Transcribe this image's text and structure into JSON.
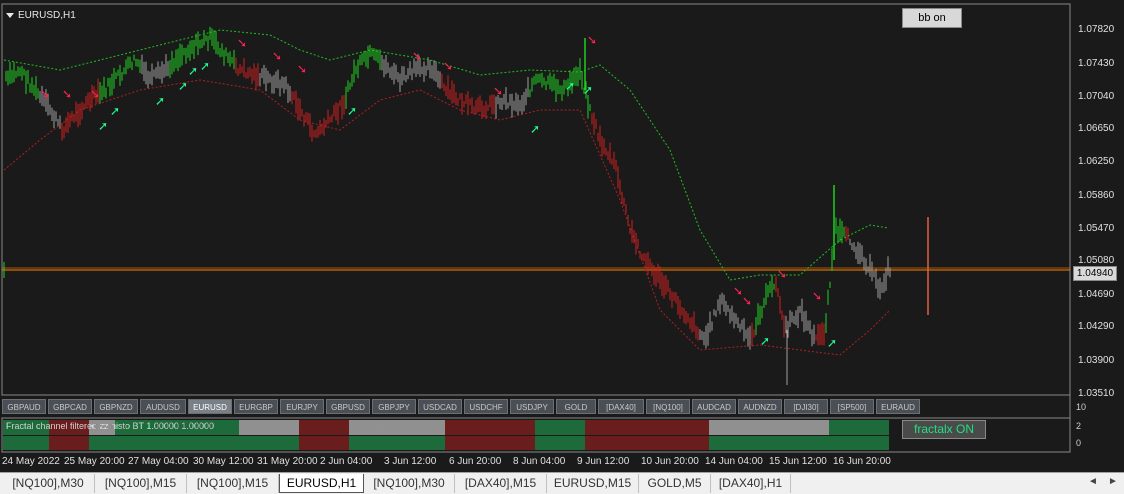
{
  "chart": {
    "title": "EURUSD,H1",
    "bb_button": "bb on",
    "current_price": "1.04940",
    "price_labels": [
      "1.07820",
      "1.07430",
      "1.07040",
      "1.06650",
      "1.06250",
      "1.05860",
      "1.05470",
      "1.05080",
      "1.04690",
      "1.04290",
      "1.03900",
      "1.03510"
    ],
    "colors": {
      "bull": "#20d020",
      "bear": "#d02020",
      "neutral": "#a0a0a0",
      "up_arrow": "#20ff90",
      "down_arrow": "#ff2050",
      "band_green": "#20c020",
      "band_red": "#b02020",
      "price_line": "#ff8000"
    }
  },
  "symbol_bar": [
    "GBPAUD",
    "GBPCAD",
    "GBPNZD",
    "AUDUSD",
    "EURUSD",
    "EURGBP",
    "EURJPY",
    "GBPUSD",
    "GBPJPY",
    "USDCAD",
    "USDCHF",
    "USDJPY",
    "GOLD",
    "[DAX40]",
    "[NQ100]",
    "AUDCAD",
    "AUDNZD",
    "[DJI30]",
    "[SP500]",
    "EURAUD"
  ],
  "symbol_active": "EURUSD",
  "indicator": {
    "label": "Fractal channel filtered zz histo BT 1.00000 1.00000",
    "button": "fractalx ON",
    "scale_top": "10",
    "scale_mid": "2",
    "scale_bottom": "0"
  },
  "time_labels": [
    "24 May 2022",
    "25 May 20:00",
    "27 May 04:00",
    "30 May 12:00",
    "31 May 20:00",
    "2 Jun 04:00",
    "3 Jun 12:00",
    "6 Jun 20:00",
    "8 Jun 04:00",
    "9 Jun 12:00",
    "10 Jun 20:00",
    "14 Jun 04:00",
    "15 Jun 12:00",
    "16 Jun 20:00"
  ],
  "tabs": [
    "[NQ100],M30",
    "[NQ100],M15",
    "[NQ100],M15",
    "EURUSD,H1",
    "[NQ100],M30",
    "[DAX40],M15",
    "EURUSD,M15",
    "GOLD,M5",
    "[DAX40],H1"
  ],
  "tab_active": "EURUSD,H1",
  "scroll": {
    "left": "◄",
    "right": "►"
  }
}
